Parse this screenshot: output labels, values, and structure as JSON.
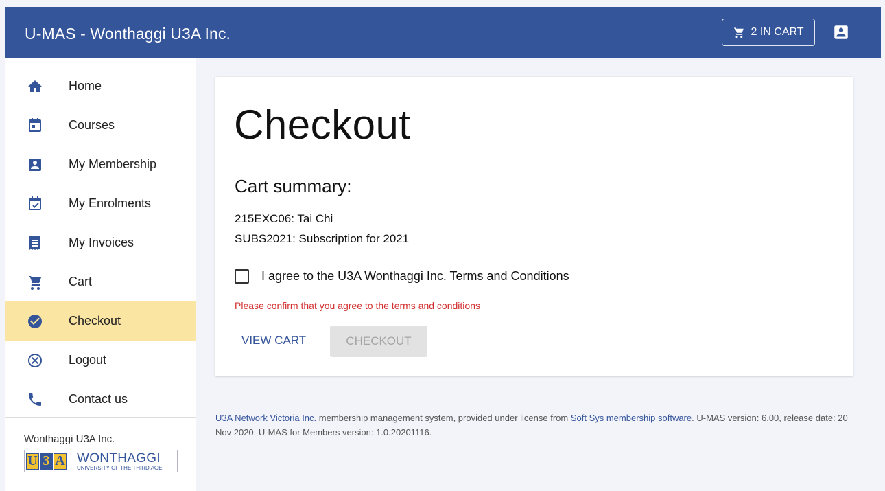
{
  "header": {
    "title": "U-MAS - Wonthaggi U3A Inc.",
    "cart_button": "2 IN CART",
    "cart_icon": "cart-icon",
    "account_icon": "account-box-icon"
  },
  "sidebar": {
    "items": [
      {
        "label": "Home",
        "icon": "home-icon"
      },
      {
        "label": "Courses",
        "icon": "calendar-icon"
      },
      {
        "label": "My Membership",
        "icon": "account-box-icon"
      },
      {
        "label": "My Enrolments",
        "icon": "calendar-check-icon"
      },
      {
        "label": "My Invoices",
        "icon": "receipt-icon"
      },
      {
        "label": "Cart",
        "icon": "cart-icon"
      },
      {
        "label": "Checkout",
        "icon": "check-circle-icon"
      },
      {
        "label": "Logout",
        "icon": "cancel-icon"
      },
      {
        "label": "Contact us",
        "icon": "phone-icon"
      }
    ],
    "active": "Checkout",
    "org_name": "Wonthaggi U3A Inc.",
    "logo": {
      "letters": [
        "U",
        "3",
        "A"
      ],
      "title": "WONTHAGGI",
      "subtitle": "UNIVERSITY OF THE THIRD AGE"
    }
  },
  "main": {
    "title": "Checkout",
    "summary_heading": "Cart summary:",
    "items": [
      "215EXC06: Tai Chi",
      "SUBS2021: Subscription for 2021"
    ],
    "agree_label": "I agree to the U3A Wonthaggi Inc. Terms and Conditions",
    "agree_checked": false,
    "error": "Please confirm that you agree to the terms and conditions",
    "view_cart_label": "VIEW CART",
    "checkout_label": "CHECKOUT",
    "checkout_enabled": false
  },
  "footer": {
    "link1": "U3A Network Victoria Inc.",
    "text1": " membership management system, provided under license from ",
    "link2": "Soft Sys membership software",
    "text2": ". U-MAS version: 6.00, release date: 20 Nov 2020. U-MAS for Members version: 1.0.20201116."
  },
  "colors": {
    "primary": "#35559a",
    "active_bg": "#fae6a2",
    "error": "#d32f2f",
    "page_bg": "#f3f4fa"
  }
}
